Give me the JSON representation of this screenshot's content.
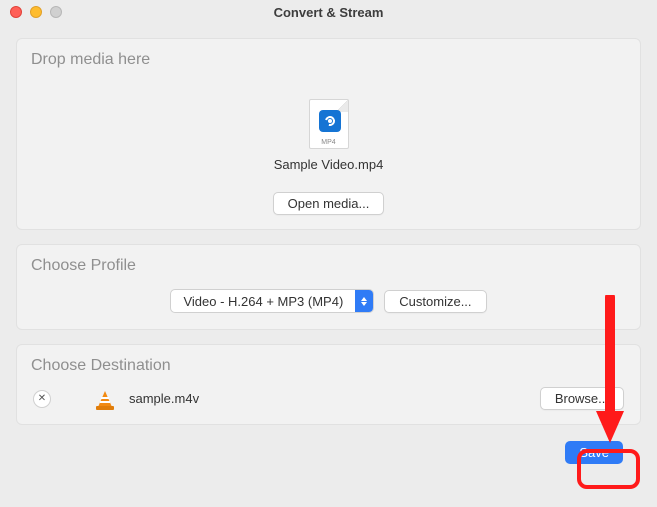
{
  "window": {
    "title": "Convert & Stream"
  },
  "drop": {
    "title": "Drop media here",
    "file_type": "MP4",
    "file_name": "Sample Video.mp4",
    "open_button": "Open media..."
  },
  "profile": {
    "title": "Choose Profile",
    "selected": "Video - H.264 + MP3 (MP4)",
    "customize_button": "Customize..."
  },
  "destination": {
    "title": "Choose Destination",
    "file": "sample.m4v",
    "browse_button": "Browse..."
  },
  "save_button": "Save",
  "annotation": {
    "arrow_color": "#ff1a1a"
  }
}
